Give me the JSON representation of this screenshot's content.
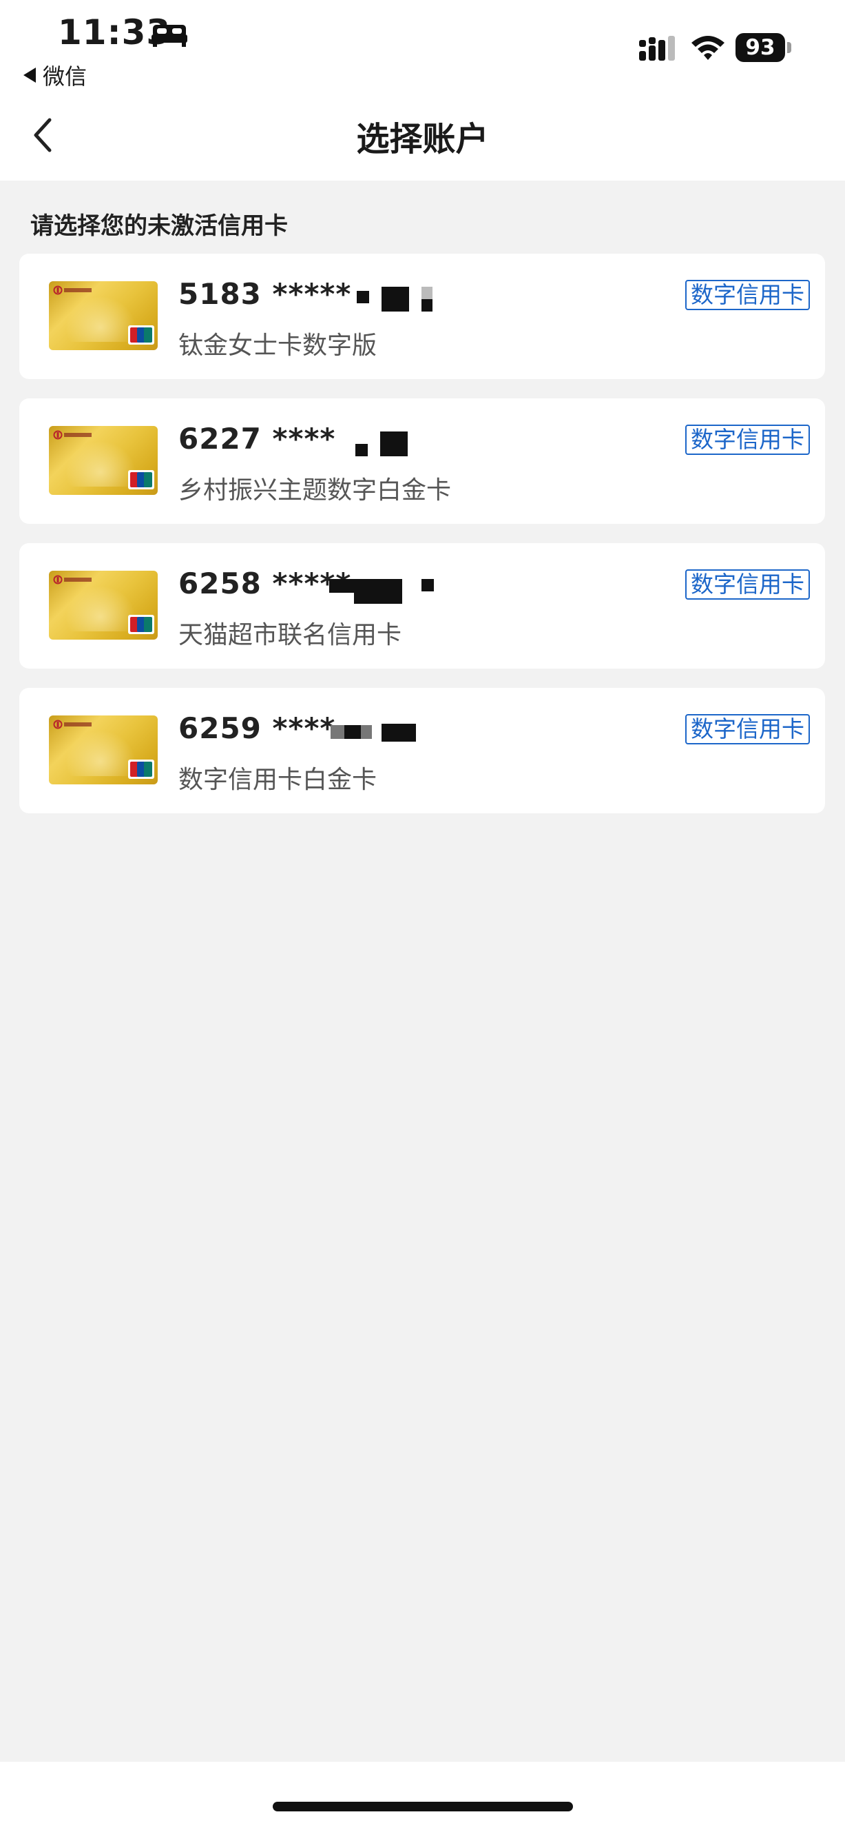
{
  "status_bar": {
    "time": "11:33",
    "back_app": "微信",
    "battery": "93"
  },
  "nav": {
    "title": "选择账户"
  },
  "section": {
    "title": "请选择您的未激活信用卡"
  },
  "cards": [
    {
      "number": "5183 *****",
      "name": "钛金女士卡数字版",
      "tag": "数字信用卡"
    },
    {
      "number": "6227 ****",
      "name": "乡村振兴主题数字白金卡",
      "tag": "数字信用卡"
    },
    {
      "number": "6258 *****",
      "name": "天猫超市联名信用卡",
      "tag": "数字信用卡"
    },
    {
      "number": "6259 ****",
      "name": "数字信用卡白金卡",
      "tag": "数字信用卡"
    }
  ]
}
